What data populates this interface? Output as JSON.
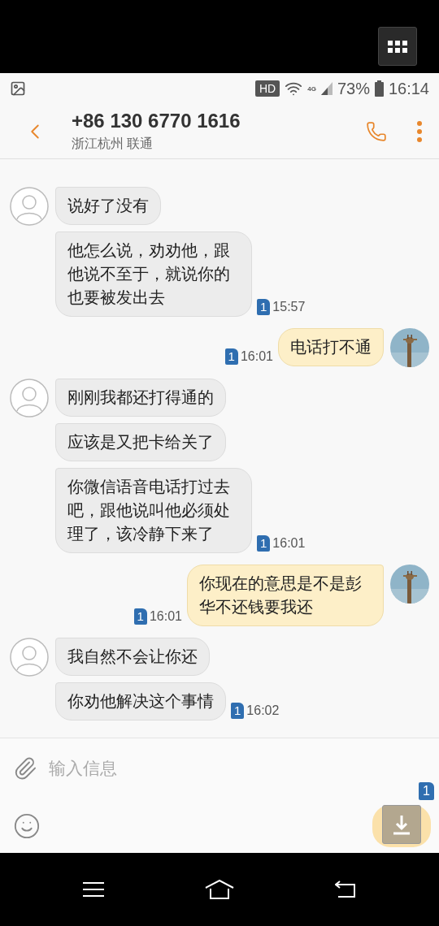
{
  "status_bar": {
    "badge": "HD",
    "network": "4G",
    "battery": "73%",
    "time": "16:14"
  },
  "header": {
    "title": "+86 130 6770 1616",
    "subtitle": "浙江杭州 联通"
  },
  "messages": [
    {
      "kind": "incoming",
      "bubbles": [
        "说好了没有",
        "他怎么说，劝劝他，跟他说不至于，就说你的也要被发出去"
      ],
      "sim": "1",
      "time": "15:57"
    },
    {
      "kind": "outgoing",
      "bubbles": [
        "电话打不通"
      ],
      "sim": "1",
      "time": "16:01"
    },
    {
      "kind": "incoming",
      "bubbles": [
        "刚刚我都还打得通的",
        "应该是又把卡给关了",
        "你微信语音电话打过去吧，跟他说叫他必须处理了，该冷静下来了"
      ],
      "sim": "1",
      "time": "16:01"
    },
    {
      "kind": "outgoing",
      "bubbles": [
        "你现在的意思是不是彭华不还钱要我还"
      ],
      "sim": "1",
      "time": "16:01"
    },
    {
      "kind": "incoming",
      "bubbles": [
        "我自然不会让你还",
        "你劝他解决这个事情"
      ],
      "sim": "1",
      "time": "16:02"
    }
  ],
  "composer": {
    "placeholder": "输入信息",
    "send_sim": "1"
  }
}
